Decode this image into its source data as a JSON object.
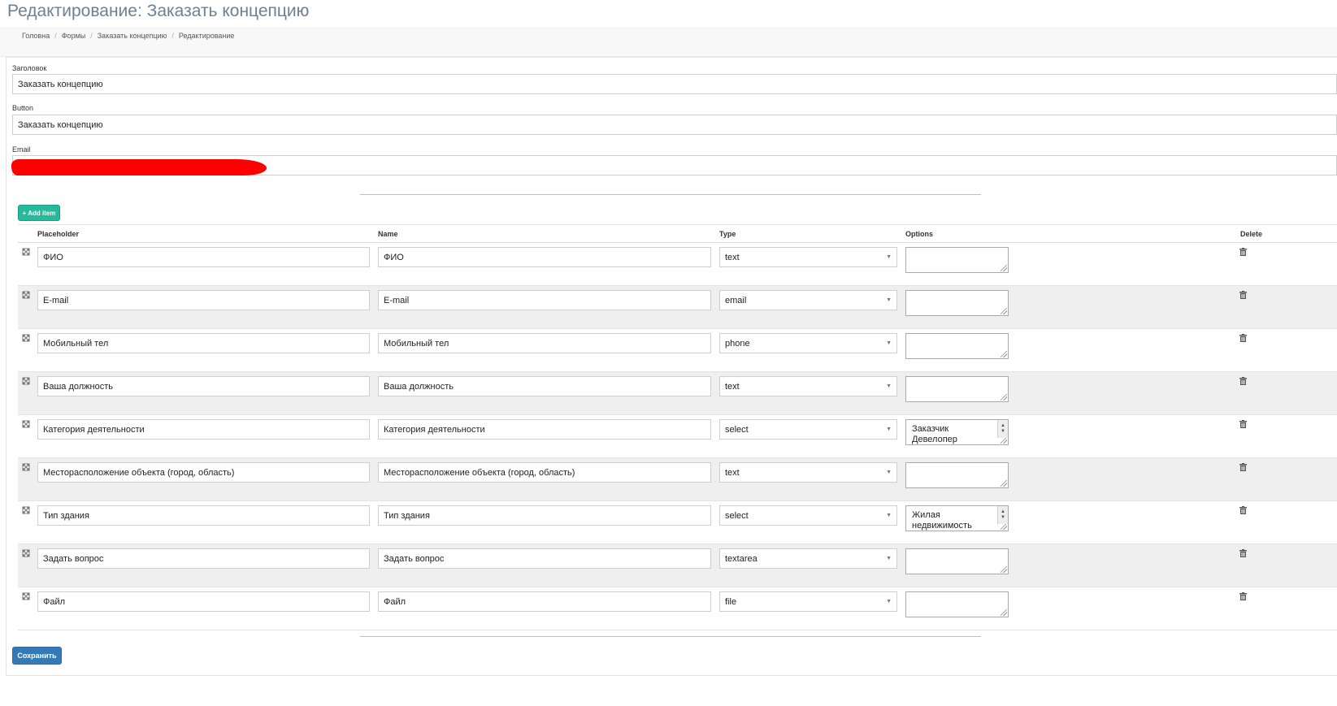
{
  "page_title": "Редактирование: Заказать концепцию",
  "breadcrumb": [
    "Головна",
    "Формы",
    "Заказать концепцию",
    "Редактирование"
  ],
  "fields": {
    "title_label": "Заголовок",
    "title_value": "Заказать концепцию",
    "button_label": "Button",
    "button_value": "Заказать концепцию",
    "email_label": "Email"
  },
  "add_item_label": "Add item",
  "table": {
    "headers": {
      "placeholder": "Placeholder",
      "name": "Name",
      "type": "Type",
      "options": "Options",
      "delete": "Delete"
    },
    "rows": [
      {
        "placeholder": "ФИО",
        "name": "ФИО",
        "type": "text",
        "options": ""
      },
      {
        "placeholder": "E-mail",
        "name": "E-mail",
        "type": "email",
        "options": ""
      },
      {
        "placeholder": "Мобильный тел",
        "name": "Мобильный тел",
        "type": "phone",
        "options": ""
      },
      {
        "placeholder": "Ваша должность",
        "name": "Ваша должность",
        "type": "text",
        "options": ""
      },
      {
        "placeholder": "Категория деятельности",
        "name": "Категория деятельности",
        "type": "select",
        "options": "Заказчик\nДевелопер"
      },
      {
        "placeholder": "Месторасположение объекта (город, область)",
        "name": "Месторасположение объекта (город, область)",
        "type": "text",
        "options": ""
      },
      {
        "placeholder": "Тип здания",
        "name": "Тип здания",
        "type": "select",
        "options": "Жилая\nнедвижимость"
      },
      {
        "placeholder": "Задать вопрос",
        "name": "Задать вопрос",
        "type": "textarea",
        "options": ""
      },
      {
        "placeholder": "Файл",
        "name": "Файл",
        "type": "file",
        "options": ""
      }
    ]
  },
  "save_label": "Сохранить",
  "colors": {
    "title": "#6e8096",
    "add_button": "#26b99a",
    "save_button": "#337ab7",
    "redaction": "#ff0000"
  },
  "icons": {
    "drag": "move-arrows-icon",
    "delete": "trash-icon",
    "add": "plus-icon"
  }
}
